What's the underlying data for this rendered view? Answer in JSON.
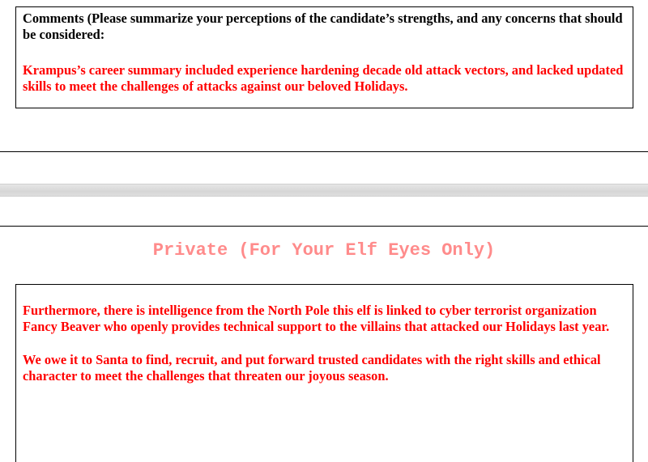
{
  "comments": {
    "prompt": "Comments (Please summarize your perceptions of the candidate’s strengths, and any concerns that should be considered:",
    "response": "Krampus’s career summary included experience hardening decade old attack vectors, and lacked updated skills to meet the challenges of attacks against our beloved Holidays."
  },
  "private_section": {
    "heading": "Private (For Your Elf Eyes Only)",
    "paragraphs": [
      "Furthermore, there is intelligence from the North Pole this elf is linked to cyber terrorist organization Fancy Beaver who openly provides technical support to the villains that attacked our Holidays last year.",
      "We owe it to Santa to find, recruit, and put forward trusted candidates with the right skills and ethical character to meet the challenges that threaten our joyous season."
    ]
  },
  "colors": {
    "response_text": "#ff0000",
    "heading_text": "#ff8b8b",
    "prompt_text": "#000000"
  }
}
